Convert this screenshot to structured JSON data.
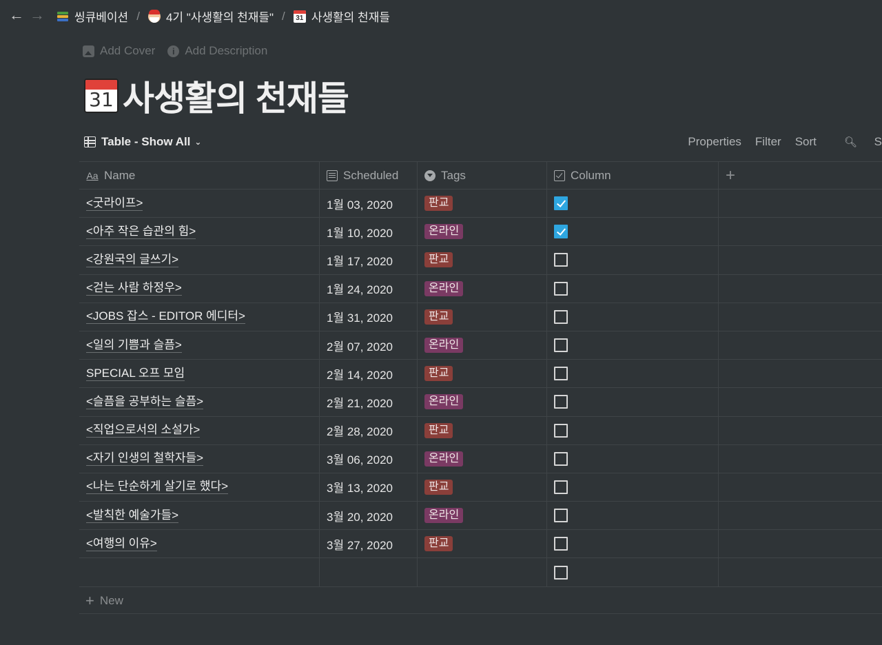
{
  "breadcrumbs": [
    {
      "label": "씽큐베이션",
      "icon": "books-icon"
    },
    {
      "label": "4기 \"사생활의 천재들\"",
      "icon": "santa-icon"
    },
    {
      "label": "사생활의 천재들",
      "icon": "calendar-icon"
    }
  ],
  "calendar_icon_text": "31",
  "meta": {
    "add_cover": "Add Cover",
    "add_description": "Add Description"
  },
  "page_title": "사생활의 천재들",
  "view": {
    "name": "Table - Show All",
    "actions": {
      "properties": "Properties",
      "filter": "Filter",
      "sort": "Sort",
      "search": "S"
    }
  },
  "columns": {
    "name": "Name",
    "scheduled": "Scheduled",
    "tags": "Tags",
    "column": "Column",
    "add": "+"
  },
  "tag_colors": {
    "판교": "#8a3f3a",
    "온라인": "#7a3a63"
  },
  "rows": [
    {
      "name": "<굿라이프>",
      "scheduled": "1월 03, 2020",
      "tag": "판교",
      "checked": true
    },
    {
      "name": "<아주 작은 습관의 힘>",
      "scheduled": "1월 10, 2020",
      "tag": "온라인",
      "checked": true
    },
    {
      "name": "<강원국의 글쓰기>",
      "scheduled": "1월 17, 2020",
      "tag": "판교",
      "checked": false
    },
    {
      "name": "<걷는 사람 하정우>",
      "scheduled": "1월 24, 2020",
      "tag": "온라인",
      "checked": false
    },
    {
      "name": "<JOBS 잡스 - EDITOR 에디터>",
      "scheduled": "1월 31, 2020",
      "tag": "판교",
      "checked": false
    },
    {
      "name": "<일의 기쁨과 슬픔>",
      "scheduled": "2월 07, 2020",
      "tag": "온라인",
      "checked": false
    },
    {
      "name": "SPECIAL 오프 모임",
      "scheduled": "2월 14, 2020",
      "tag": "판교",
      "checked": false
    },
    {
      "name": "<슬픔을 공부하는 슬픔>",
      "scheduled": "2월 21, 2020",
      "tag": "온라인",
      "checked": false
    },
    {
      "name": "<직업으로서의 소설가>",
      "scheduled": "2월 28, 2020",
      "tag": "판교",
      "checked": false
    },
    {
      "name": "<자기 인생의 철학자들>",
      "scheduled": "3월 06, 2020",
      "tag": "온라인",
      "checked": false
    },
    {
      "name": "<나는 단순하게 살기로 했다>",
      "scheduled": "3월 13, 2020",
      "tag": "판교",
      "checked": false
    },
    {
      "name": "<발칙한 예술가들>",
      "scheduled": "3월 20, 2020",
      "tag": "온라인",
      "checked": false
    },
    {
      "name": "<여행의 이유>",
      "scheduled": "3월 27, 2020",
      "tag": "판교",
      "checked": false
    },
    {
      "name": "",
      "scheduled": "",
      "tag": "",
      "checked": false
    }
  ],
  "new_label": "New"
}
